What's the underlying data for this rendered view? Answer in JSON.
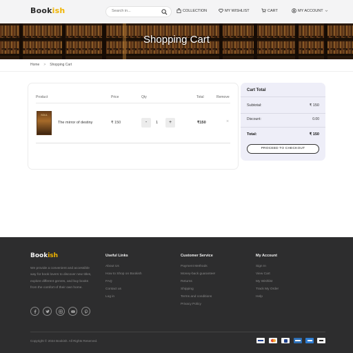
{
  "header": {
    "logo_main": "Book",
    "logo_accent": "ish",
    "search_placeholder": "Search in...",
    "nav": {
      "collection": "COLLECTION",
      "wishlist": "MY WISHLIST",
      "cart": "CART",
      "account": "MY ACCOUNT"
    }
  },
  "hero": {
    "title": "Shopping Cart"
  },
  "breadcrumb": {
    "home": "Home",
    "sep": ">",
    "current": "Shopping Cart"
  },
  "cart": {
    "columns": {
      "product": "Product",
      "price": "Price",
      "qty": "Qty",
      "total": "Total",
      "remove": "Remove"
    },
    "items": [
      {
        "cover_text": "SOUL",
        "name": "The mirror of destiny",
        "price": "₹ 150",
        "qty": "1",
        "total": "₹150",
        "remove": "×"
      }
    ],
    "minus": "-",
    "plus": "+"
  },
  "summary": {
    "title": "Cart Total",
    "subtotal_label": "Subtotal:",
    "subtotal_value": "₹ 150",
    "discount_label": "Discount:",
    "discount_value": "0.00",
    "total_label": "Total:",
    "total_value": "₹ 150",
    "checkout": "PROCEED TO CHECKOUT"
  },
  "footer": {
    "logo_main": "Book",
    "logo_accent": "ish",
    "about": "We provide a convenient and accessible way for book lovers to discover new titles, explore different genres, and buy books from the comfort of their own home.",
    "useful_links": {
      "title": "Useful Links",
      "items": [
        "About Us",
        "How to Shop on Bookish",
        "FAQ",
        "Contact us",
        "Log in"
      ]
    },
    "customer_service": {
      "title": "Customer Service",
      "items": [
        "Payment Methods",
        "Money-back guarantee!",
        "Returns",
        "Shipping",
        "Terms and conditions",
        "Privacy Policy"
      ]
    },
    "my_account": {
      "title": "My Account",
      "items": [
        "Sign In",
        "View Cart",
        "My Wishlist",
        "Track My Order",
        "Help"
      ]
    },
    "copyright": "Copyright © 2024 Bookish. All Rights Reserved.",
    "social_icons": [
      "facebook-icon",
      "twitter-icon",
      "instagram-icon",
      "youtube-icon",
      "pinterest-icon"
    ],
    "payment_icons": [
      "visa-icon",
      "mastercard-icon",
      "paypal-icon",
      "card-icon",
      "amex-icon",
      "applepay-icon"
    ]
  },
  "colors": {
    "accent": "#f0b400",
    "footer_bg": "#2d2d2e",
    "summary_bg": "#eeeef8"
  }
}
